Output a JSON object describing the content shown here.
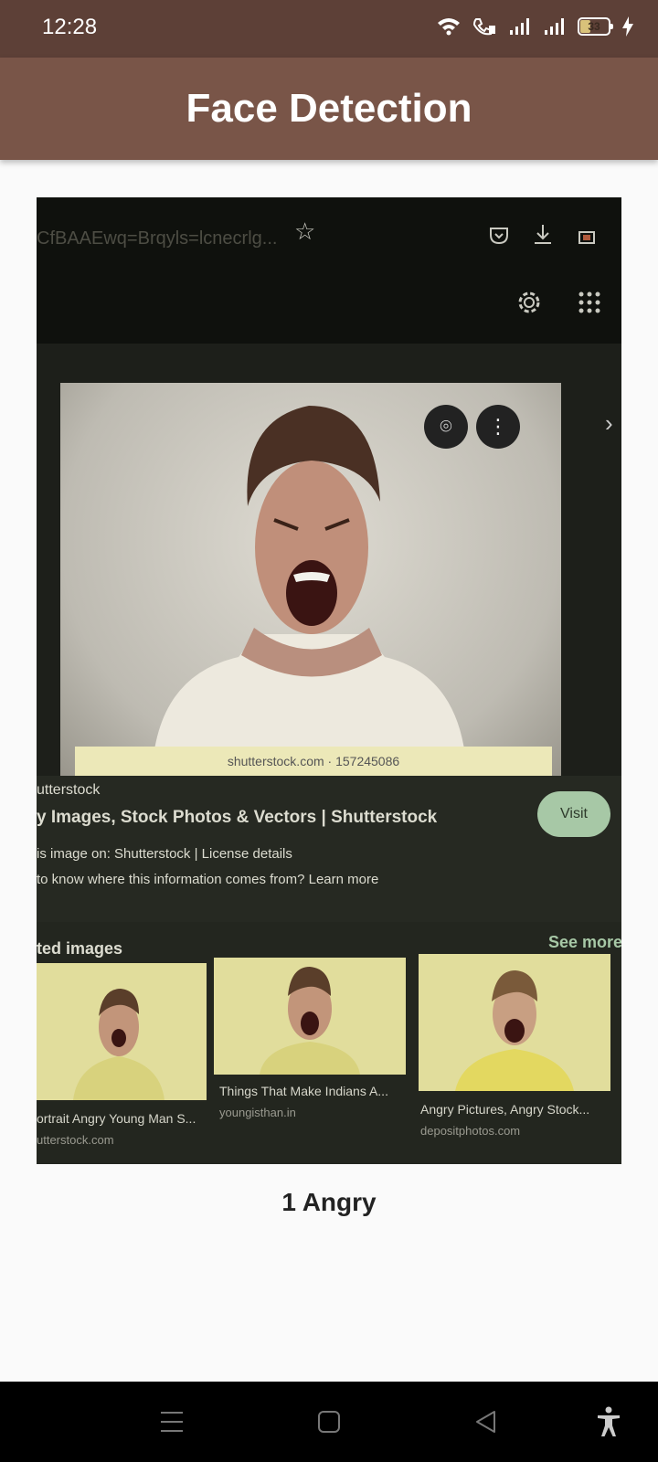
{
  "status_bar": {
    "time": "12:28",
    "battery_level": "33",
    "icons": [
      "wifi-icon",
      "wifi-calling-icon",
      "signal-1-icon",
      "signal-2-icon",
      "battery-icon",
      "charging-icon"
    ]
  },
  "app_bar": {
    "title": "Face Detection",
    "background": "#795548"
  },
  "photo": {
    "url_text": "CfBAAEwq=Brqyls=lcnecrlg...",
    "caption": "shutterstock.com · 157245086",
    "source_name": "utterstock",
    "page_title": "y Images, Stock Photos & Vectors | Shutterstock",
    "usage_line": "is image on: Shutterstock | License details",
    "info_line": "to know where this information comes from? Learn more",
    "visit_label": "Visit",
    "related_title": "ted images",
    "see_more_label": "See more",
    "related": [
      {
        "label": "ortrait Angry Young Man S...",
        "source": "utterstock.com"
      },
      {
        "label": "Things That Make Indians A...",
        "source": "youngisthan.in"
      },
      {
        "label": "Angry Pictures, Angry Stock...",
        "source": "depositphotos.com"
      }
    ]
  },
  "result": {
    "label": "1 Angry"
  },
  "nav": {
    "icons": [
      "menu-icon",
      "home-icon",
      "back-icon",
      "accessibility-icon"
    ]
  }
}
